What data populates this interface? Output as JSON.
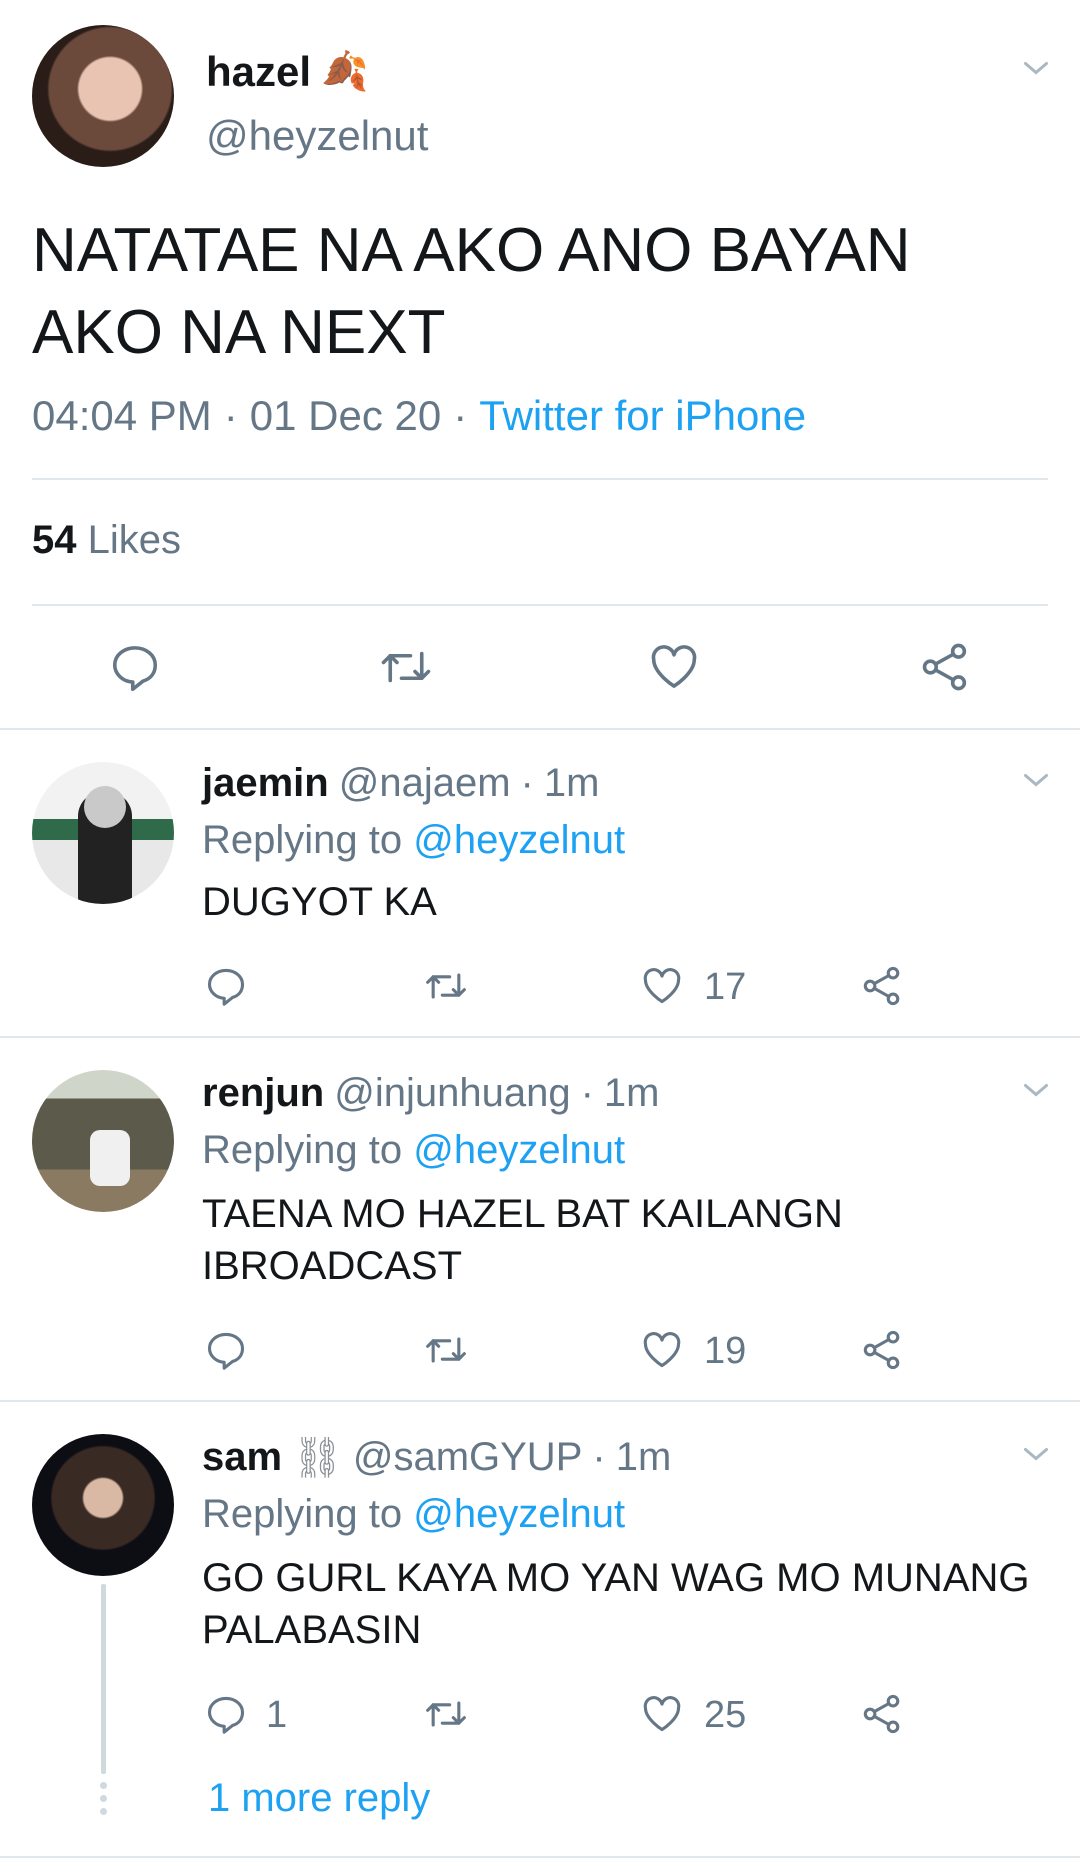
{
  "colors": {
    "text": "#14171a",
    "muted": "#657786",
    "accent": "#1da1f2",
    "divider": "#e1e8ed"
  },
  "main_tweet": {
    "display_name": "hazel",
    "name_emoji": "🍂",
    "handle": "@heyzelnut",
    "text_line1": "NATATAE NA AKO ANO BAYAN",
    "text_line2": "AKO NA NEXT",
    "time": "04:04 PM",
    "date": "01 Dec 20",
    "source": "Twitter for iPhone",
    "likes_count": "54",
    "likes_label": "Likes",
    "icons": [
      "reply-icon",
      "retweet-icon",
      "like-icon",
      "share-icon",
      "chevron-down-icon"
    ]
  },
  "replies": [
    {
      "display_name": "jaemin",
      "handle": "@najaem",
      "time": "1m",
      "replying_prefix": "Replying to",
      "replying_handle": "@heyzelnut",
      "text_line1": "DUGYOT KA",
      "text_line2": "",
      "reply_count": "",
      "retweet_count": "",
      "like_count": "17"
    },
    {
      "display_name": "renjun",
      "handle": "@injunhuang",
      "time": "1m",
      "replying_prefix": "Replying to",
      "replying_handle": "@heyzelnut",
      "text_line1": "TAENA MO HAZEL BAT KAILANGN",
      "text_line2": "IBROADCAST",
      "reply_count": "",
      "retweet_count": "",
      "like_count": "19"
    },
    {
      "display_name": "sam",
      "name_emoji": "⛓",
      "handle": "@samGYUP",
      "time": "1m",
      "replying_prefix": "Replying to",
      "replying_handle": "@heyzelnut",
      "text_line1": "GO GURL KAYA MO YAN WAG MO MUNANG",
      "text_line2": "PALABASIN",
      "reply_count": "1",
      "retweet_count": "",
      "like_count": "25"
    }
  ],
  "more_replies_label": "1 more reply"
}
